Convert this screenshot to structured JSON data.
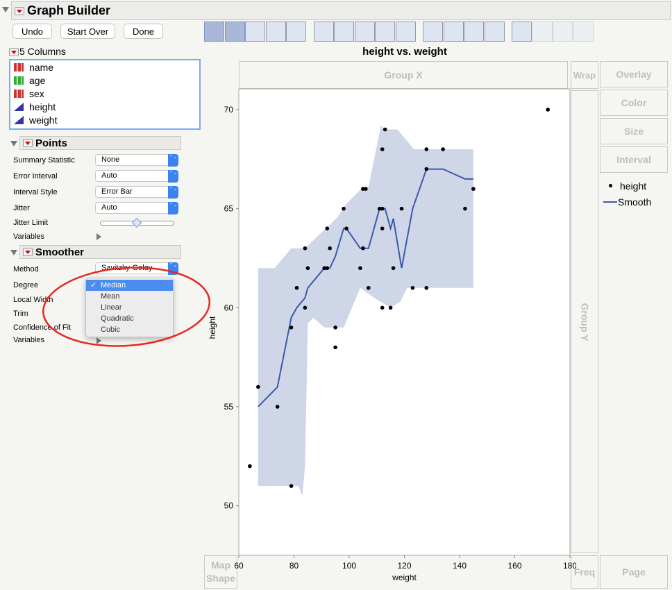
{
  "window": {
    "title": "Graph Builder"
  },
  "buttons": {
    "undo": "Undo",
    "start_over": "Start Over",
    "done": "Done"
  },
  "toolbar": {
    "icons": [
      "points-icon",
      "smoother-icon",
      "line-of-fit-icon",
      "ellipse-icon",
      "contour-icon",
      "line-icon",
      "bar-icon",
      "area-icon",
      "box-plot-icon",
      "histogram-icon",
      "heatmap-icon",
      "pie-icon",
      "treemap-icon",
      "mosaic-icon",
      "caption-box-icon",
      "formula-icon",
      "map-shapes-icon",
      "parallel-icon"
    ]
  },
  "columns": {
    "header": "5 Columns",
    "items": [
      {
        "name": "name",
        "type": "nominal"
      },
      {
        "name": "age",
        "type": "ordinal"
      },
      {
        "name": "sex",
        "type": "nominal"
      },
      {
        "name": "height",
        "type": "continuous"
      },
      {
        "name": "weight",
        "type": "continuous"
      }
    ]
  },
  "points": {
    "title": "Points",
    "summary_statistic_label": "Summary Statistic",
    "summary_statistic": "None",
    "error_interval_label": "Error Interval",
    "error_interval": "Auto",
    "interval_style_label": "Interval Style",
    "interval_style": "Error Bar",
    "jitter_label": "Jitter",
    "jitter": "Auto",
    "jitter_limit_label": "Jitter Limit",
    "jitter_limit": 0.5,
    "variables_label": "Variables"
  },
  "smoother": {
    "title": "Smoother",
    "method_label": "Method",
    "method": "Savitzky-Golay",
    "degree_label": "Degree",
    "local_width_label": "Local Width",
    "trim_label": "Trim",
    "confidence_label": "Confidence of Fit",
    "variables_label": "Variables"
  },
  "degree_menu": {
    "selected": "Median",
    "options": [
      "Median",
      "Mean",
      "Linear",
      "Quadratic",
      "Cubic"
    ]
  },
  "zones": {
    "group_x": "Group X",
    "group_y": "Group Y",
    "wrap": "Wrap",
    "overlay": "Overlay",
    "color": "Color",
    "size": "Size",
    "interval": "Interval",
    "freq": "Freq",
    "page": "Page",
    "map_shape": "Map Shape"
  },
  "legend": {
    "points": "height",
    "smooth": "Smooth"
  },
  "colors": {
    "accent": "#3b82f0",
    "line": "#3a59a8",
    "band": "#cfd6e8",
    "annotation": "#e8281e"
  },
  "chart_data": {
    "type": "scatter",
    "title": "height vs. weight",
    "xlabel": "weight",
    "ylabel": "height",
    "xlim": [
      60,
      180
    ],
    "ylim": [
      47.5,
      71.05
    ],
    "xticks": [
      60,
      80,
      100,
      120,
      140,
      160,
      180
    ],
    "yticks": [
      50,
      55,
      60,
      65,
      70
    ],
    "points": [
      [
        64,
        52
      ],
      [
        67,
        56
      ],
      [
        74,
        55
      ],
      [
        79,
        51
      ],
      [
        79,
        59
      ],
      [
        81,
        61
      ],
      [
        84,
        60
      ],
      [
        84,
        63
      ],
      [
        85,
        62
      ],
      [
        91,
        62
      ],
      [
        92,
        62
      ],
      [
        92,
        64
      ],
      [
        93,
        63
      ],
      [
        95,
        59
      ],
      [
        95,
        58
      ],
      [
        98,
        65
      ],
      [
        99,
        64
      ],
      [
        104,
        62
      ],
      [
        105,
        63
      ],
      [
        105,
        66
      ],
      [
        106,
        66
      ],
      [
        107,
        61
      ],
      [
        111,
        65
      ],
      [
        112,
        65
      ],
      [
        112,
        64
      ],
      [
        112,
        68
      ],
      [
        113,
        69
      ],
      [
        112,
        60
      ],
      [
        115,
        60
      ],
      [
        116,
        62
      ],
      [
        119,
        65
      ],
      [
        123,
        61
      ],
      [
        128,
        61
      ],
      [
        128,
        68
      ],
      [
        128,
        67
      ],
      [
        134,
        68
      ],
      [
        142,
        65
      ],
      [
        145,
        66
      ],
      [
        172,
        70
      ]
    ],
    "smooth": [
      [
        67,
        55
      ],
      [
        74,
        56
      ],
      [
        79,
        59.5
      ],
      [
        81,
        60
      ],
      [
        84,
        60.5
      ],
      [
        85,
        61
      ],
      [
        91,
        62
      ],
      [
        93,
        62
      ],
      [
        95,
        62.6
      ],
      [
        98,
        64
      ],
      [
        99,
        64
      ],
      [
        104,
        63
      ],
      [
        107,
        63
      ],
      [
        111,
        65
      ],
      [
        113,
        65
      ],
      [
        115,
        64
      ],
      [
        116,
        64.5
      ],
      [
        119,
        62
      ],
      [
        123,
        65
      ],
      [
        128,
        67
      ],
      [
        134,
        67
      ],
      [
        142,
        66.5
      ],
      [
        145,
        66.5
      ]
    ],
    "band_upper": [
      [
        67,
        62
      ],
      [
        73,
        62
      ],
      [
        79,
        63
      ],
      [
        81,
        63
      ],
      [
        84,
        63
      ],
      [
        96,
        64.6
      ],
      [
        98,
        65.1
      ],
      [
        105,
        66.1
      ],
      [
        107,
        66.1
      ],
      [
        111.5,
        69.2
      ],
      [
        113,
        69
      ],
      [
        117.5,
        69
      ],
      [
        123.5,
        68
      ],
      [
        145,
        68
      ]
    ],
    "band_lower": [
      [
        145,
        61
      ],
      [
        121,
        61
      ],
      [
        118.5,
        60.3
      ],
      [
        115,
        60
      ],
      [
        109,
        60.5
      ],
      [
        104,
        61
      ],
      [
        98,
        59
      ],
      [
        91,
        59
      ],
      [
        87,
        59.5
      ],
      [
        85,
        59.2
      ],
      [
        84,
        52
      ],
      [
        83,
        50.5
      ],
      [
        81.6,
        51
      ],
      [
        67,
        51
      ]
    ]
  }
}
